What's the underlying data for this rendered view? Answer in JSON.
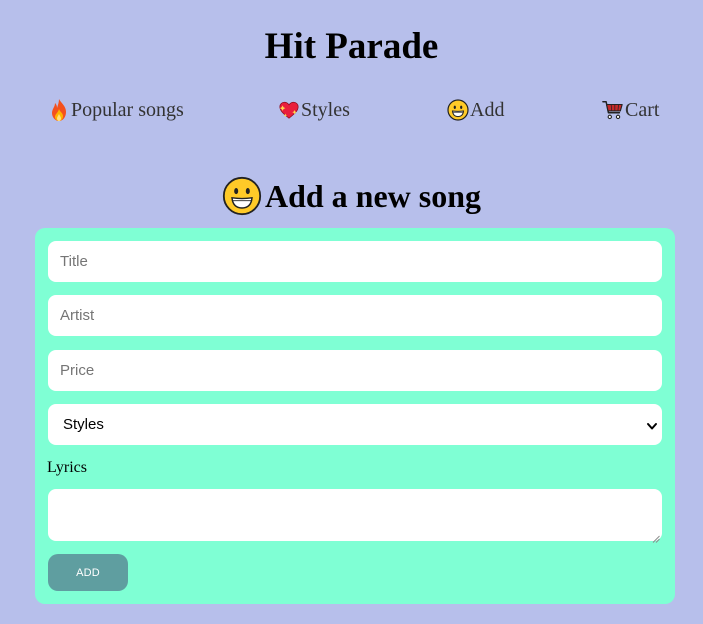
{
  "header": {
    "title": "Hit Parade"
  },
  "nav": {
    "items": [
      {
        "icon": "fire-icon",
        "label": "Popular songs"
      },
      {
        "icon": "sparkling-heart-icon",
        "label": "Styles"
      },
      {
        "icon": "grinning-face-icon",
        "label": "Add"
      },
      {
        "icon": "shopping-cart-icon",
        "label": "Cart"
      }
    ]
  },
  "page": {
    "heading_icon": "grinning-face-icon",
    "heading": "Add a new song"
  },
  "form": {
    "title_placeholder": "Title",
    "artist_placeholder": "Artist",
    "price_placeholder": "Price",
    "style_selected": "Styles",
    "lyrics_label": "Lyrics",
    "add_button": "ADD"
  },
  "colors": {
    "background": "#b7bfeb",
    "form_panel": "#7fffd4",
    "button": "#5f9ea0",
    "button_text": "#ffffff"
  }
}
